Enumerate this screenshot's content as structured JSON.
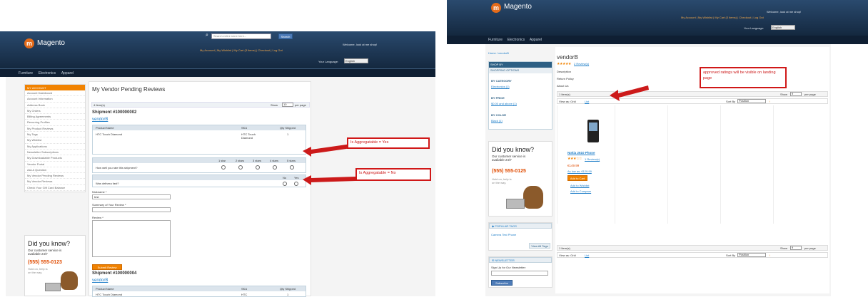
{
  "left": {
    "header": {
      "logo_text": "Magento",
      "search_placeholder": "Search entire store here...",
      "search_button": "Search",
      "welcome": "Welcome, look at me shop!",
      "links": "My Account | My Wishlist | My Cart (3 items) | Checkout | Log Out",
      "language_label": "Your Language:",
      "language_value": "English"
    },
    "nav": [
      "Furniture",
      "Electronics",
      "Apparel"
    ],
    "sidebar": {
      "title": "MY ACCOUNT",
      "items": [
        "Account Dashboard",
        "Account Information",
        "Address Book",
        "My Orders",
        "Billing Agreements",
        "Recurring Profiles",
        "My Product Reviews",
        "My Tags",
        "My Wishlist",
        "My Applications",
        "Newsletter Subscriptions",
        "My Downloadable Products",
        "Vendor Portal",
        "Ask A Question",
        "My Vendor Pending Reviews",
        "My Vendor Reviews",
        "Check Your Gift Card Balance"
      ]
    },
    "didyouknow": {
      "title": "Did you know?",
      "sub": "Our customer service is available 24/7",
      "phone": "(555) 555-0123",
      "note": "Hold on, help is on the way."
    },
    "main": {
      "title": "My Vendor Pending Reviews",
      "items_count": "4 Item(s)",
      "show_label": "Show",
      "show_value": "10",
      "per_page": "per page",
      "shipment1": "Shipment #100000002",
      "vendor1": "vendorB",
      "col_product": "Product Name",
      "col_sku": "SKU",
      "col_qty": "Qty Shipped",
      "product1": "HTC Touch Diamond",
      "sku1": "HTC Touch Diamond",
      "qty1": "1",
      "rating_cols": [
        "1 star",
        "2 stars",
        "3 stars",
        "4 stars",
        "5 stars"
      ],
      "question1": "How well you rate this shipment?",
      "yn_cols": [
        "No",
        "Yes"
      ],
      "question2": "Was delivery fast?",
      "nickname_label": "Nickname *",
      "nickname_value": "test",
      "summary_label": "Summary of Your Review *",
      "review_label": "Review *",
      "submit": "Submit Review",
      "shipment2": "Shipment #100000004",
      "vendor2": "vendorB",
      "product2": "HTC Touch Diamond",
      "sku2": "HTC",
      "qty2": "1"
    },
    "callouts": {
      "aggregatable": "Is Aggregatable = Yes",
      "not_aggregatable": "Is Aggregatable = No"
    }
  },
  "right": {
    "header": {
      "logo_text": "Magento",
      "welcome": "Welcome, look at me shop!",
      "links": "My Account | My Wishlist | My Cart (3 items) | Checkout | Log Out",
      "language_label": "Your Language:",
      "language_value": "English"
    },
    "nav": [
      "Furniture",
      "Electronics",
      "Apparel"
    ],
    "breadcrumb": "Home / vendorB",
    "shopby": {
      "title": "SHOP BY",
      "subtitle": "SHOPPING OPTIONS",
      "filters": [
        {
          "title": "BY CATEGORY",
          "value": "Electronics (1)"
        },
        {
          "title": "BY PRICE",
          "value": "$0.00 and above (1)"
        },
        {
          "title": "BY COLOR",
          "value": "Black (1)"
        }
      ]
    },
    "didyouknow": {
      "title": "Did you know?",
      "sub": "Our customer service is available 24/7",
      "phone": "(555) 555-0125",
      "note": "Hold on, help is on the way."
    },
    "popular_tags": {
      "title": "POPULAR TAGS",
      "tags": "Camera  Test  Phone",
      "view_all": "View All Tags"
    },
    "newsletter": {
      "title": "NEWSLETTER",
      "label": "Sign Up for Our Newsletter:",
      "button": "Subscribe"
    },
    "vendor": {
      "name": "vendorB",
      "stars": "★★★★★",
      "reviews": "2 Review(s)",
      "links": [
        "Description",
        "Return Policy",
        "About Us"
      ],
      "items_count": "1 Item(s)",
      "show_label": "Show",
      "show_value": "9",
      "per_page": "per page",
      "view_as": "View as: Grid",
      "list": "List",
      "sort_by": "Sort By",
      "sort_value": "Position"
    },
    "product": {
      "name": "Nokia 2610 Phone",
      "stars": "★★★☆☆",
      "reviews": "1 Review(s)",
      "price": "€149.99",
      "as_low": "As low as: €129.99",
      "add_to_cart": "Add to Cart",
      "wishlist": "Add to Wishlist",
      "compare": "Add to Compare"
    },
    "callout": "approved ratings will be visible on landing page"
  }
}
